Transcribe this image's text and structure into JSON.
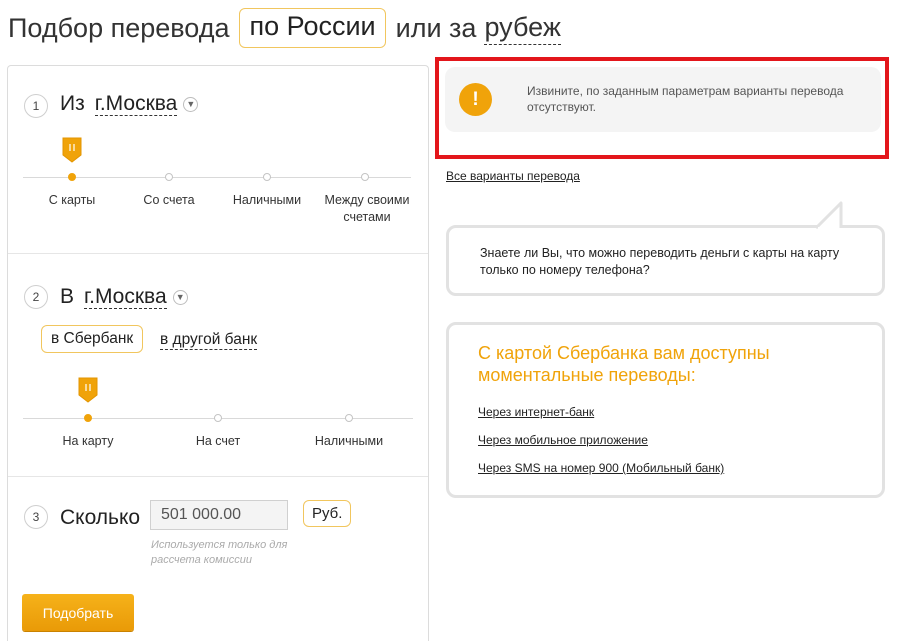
{
  "header": {
    "prefix": "Подбор перевода",
    "active_option": "по России",
    "connector": "или за",
    "other_option": "рубеж"
  },
  "step1": {
    "number": "1",
    "title": "Из",
    "city": "г.Москва",
    "options": [
      "С карты",
      "Со счета",
      "Наличными",
      "Между своими счетами"
    ],
    "selected_index": 0
  },
  "step2": {
    "number": "2",
    "title": "В",
    "city": "г.Москва",
    "bank_active": "в Сбербанк",
    "bank_other": "в другой банк",
    "options": [
      "На карту",
      "На счет",
      "Наличными"
    ],
    "selected_index": 0
  },
  "step3": {
    "number": "3",
    "title": "Сколько",
    "amount_value": "501 000.00",
    "currency": "Руб.",
    "hint": "Используется только для рассчета комиссии"
  },
  "submit_label": "Подобрать",
  "alert": {
    "icon_glyph": "!",
    "message": "Извините, по заданным параметрам варианты перевода отсутствуют."
  },
  "all_variants_link": "Все варианты перевода",
  "tip": {
    "text": "Знаете ли Вы, что можно переводить деньги с карты на карту только по номеру телефона?"
  },
  "sber_card": {
    "title": "С картой Сбербанка вам доступны моментальные переводы:",
    "links": [
      "Через интернет-банк",
      "Через мобильное приложение",
      "Через SMS на номер 900 (Мобильный банк)"
    ]
  },
  "colors": {
    "accent": "#f0a30a",
    "pill_border": "#f1c65e",
    "highlight_frame": "#e3161b"
  }
}
